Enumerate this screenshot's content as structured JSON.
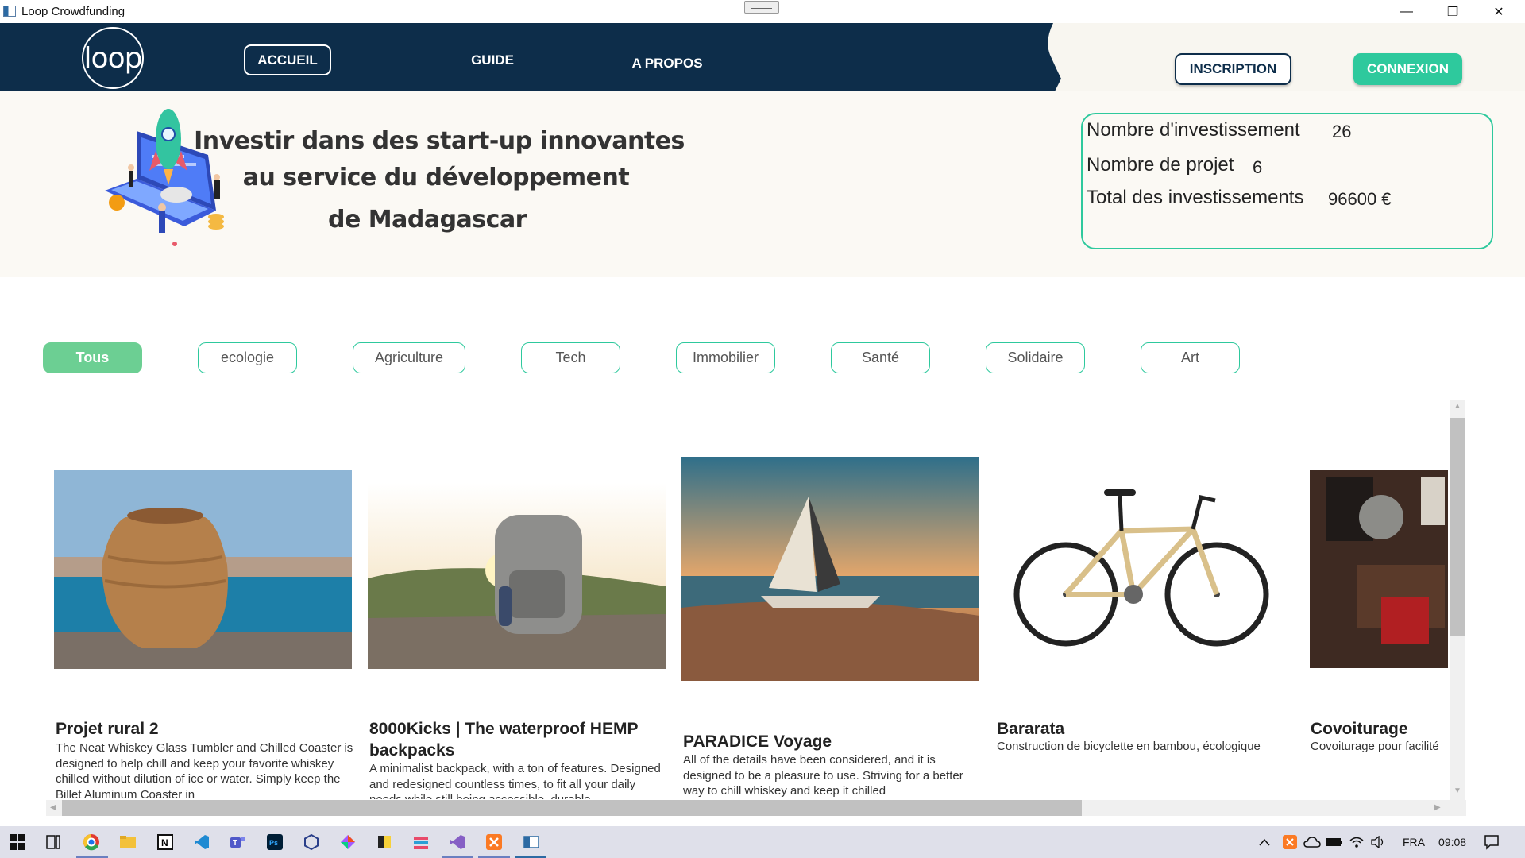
{
  "window": {
    "title": "Loop Crowdfunding",
    "minimize": "—",
    "restore": "❐",
    "close": "✕"
  },
  "header": {
    "logo_text": "loop",
    "nav": {
      "accueil": "ACCUEIL",
      "guide": "GUIDE",
      "apropos": "A PROPOS"
    },
    "inscription": "INSCRIPTION",
    "connexion": "CONNEXION",
    "colors": {
      "navy": "#0d2d4a",
      "accent": "#2ec99d",
      "active_filter": "#6ccf93"
    }
  },
  "hero": {
    "line1": "Investir dans des start-up innovantes",
    "line2": "au service du développement",
    "line3": "de Madagascar"
  },
  "stats": {
    "investments_label": "Nombre d'investissement",
    "investments_value": "26",
    "projects_label": "Nombre de projet",
    "projects_value": "6",
    "total_label": "Total des investissements",
    "total_value": "96600 €"
  },
  "filters": [
    "Tous",
    "ecologie",
    "Agriculture",
    "Tech",
    "Immobilier",
    "Santé",
    "Solidaire",
    "Art"
  ],
  "active_filter": "Tous",
  "projects": [
    {
      "title": "Projet rural 2",
      "description": "The Neat Whiskey Glass Tumbler and Chilled Coaster is designed to help chill and keep your favorite whiskey chilled without dilution of ice or water. Simply keep the Billet Aluminum Coaster in",
      "image": "clay-vase-by-sea"
    },
    {
      "title": "8000Kicks | The waterproof HEMP backpacks",
      "description": "A minimalist backpack, with a ton of features. Designed and redesigned countless times, to fit all your daily needs while still being accessible, durable",
      "image": "backpack-on-rock-at-sunset"
    },
    {
      "title": "PARADICE Voyage",
      "description": "All of the details have been considered, and it is designed to be a pleasure to use. Striving for a better way to chill whiskey and keep it chilled",
      "image": "sailboat-on-beach-at-sunset"
    },
    {
      "title": "Bararata",
      "description": "Construction de bicyclette en bambou, écologique",
      "image": "bamboo-bicycle"
    },
    {
      "title": "Covoiturage",
      "description": "Covoiturage pour facilité",
      "image": "car-interior"
    }
  ],
  "taskbar": {
    "language": "FRA",
    "time": "09:08"
  }
}
